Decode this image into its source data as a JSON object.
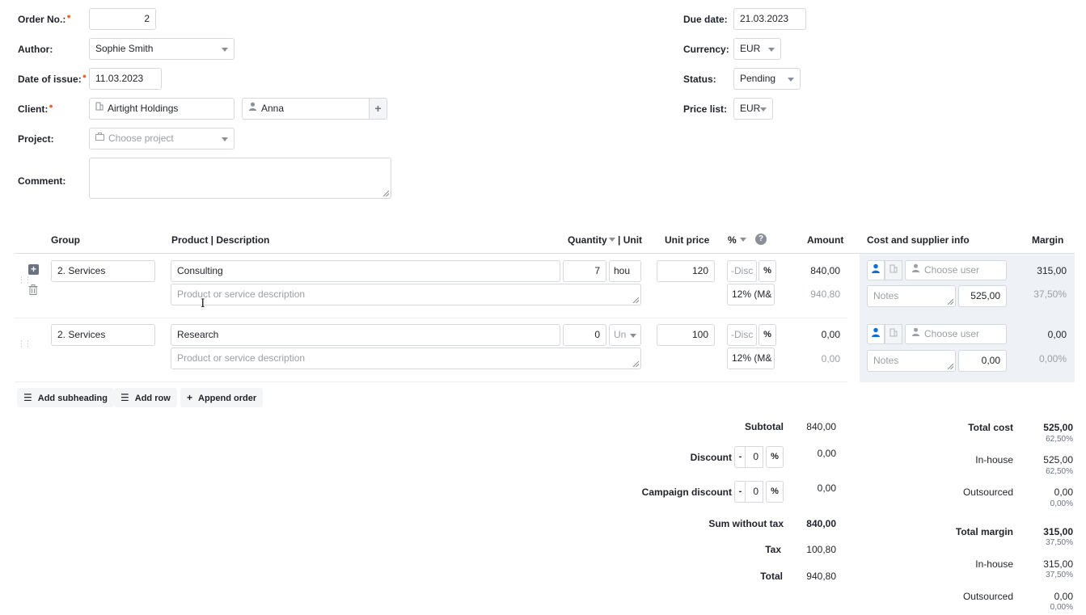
{
  "form": {
    "order_no_label": "Order No.:",
    "order_no_value": "2",
    "author_label": "Author:",
    "author_value": "Sophie Smith",
    "date_of_issue_label": "Date of issue:",
    "date_of_issue_value": "11.03.2023",
    "client_label": "Client:",
    "client_value": "Airtight Holdings",
    "contact_value": "Anna",
    "project_label": "Project:",
    "project_placeholder": "Choose project",
    "comment_label": "Comment:",
    "due_date_label": "Due date:",
    "due_date_value": "21.03.2023",
    "currency_label": "Currency:",
    "currency_value": "EUR",
    "status_label": "Status:",
    "status_value": "Pending",
    "price_list_label": "Price list:",
    "price_list_value": "EUR"
  },
  "table": {
    "headers": {
      "group": "Group",
      "product": "Product | Description",
      "quantity": "Quantity",
      "unit": "| Unit",
      "unit_price": "Unit price",
      "percent": "%",
      "amount": "Amount",
      "cost_supplier": "Cost and supplier info",
      "margin": "Margin"
    },
    "rows": [
      {
        "group": "2. Services",
        "product": "Consulting",
        "description_placeholder": "Product or service description",
        "quantity": "7",
        "unit": "hou",
        "unit_price": "120",
        "discount_placeholder": "-Disc",
        "discount_unit": "%",
        "tax": "12% (M&",
        "amount": "840,00",
        "amount_with_tax": "940,80",
        "user_placeholder": "Choose user",
        "notes_placeholder": "Notes",
        "cost": "525,00",
        "margin": "315,00",
        "margin_pct": "37,50%"
      },
      {
        "group": "2. Services",
        "product": "Research",
        "description_placeholder": "Product or service description",
        "quantity": "0",
        "unit": "Un",
        "unit_price": "100",
        "discount_placeholder": "-Disc",
        "discount_unit": "%",
        "tax": "12% (M&",
        "amount": "0,00",
        "amount_with_tax": "0,00",
        "user_placeholder": "Choose user",
        "notes_placeholder": "Notes",
        "cost": "0,00",
        "margin": "0,00",
        "margin_pct": "0,00%"
      }
    ]
  },
  "toolbar": {
    "add_subheading": "Add subheading",
    "add_row": "Add row",
    "append_order": "Append order"
  },
  "totals": {
    "subtotal_label": "Subtotal",
    "subtotal_value": "840,00",
    "discount_label": "Discount",
    "discount_sign": "-",
    "discount_input": "0",
    "discount_unit": "%",
    "discount_value": "0,00",
    "campaign_label": "Campaign discount",
    "campaign_sign": "-",
    "campaign_input": "0",
    "campaign_unit": "%",
    "campaign_value": "0,00",
    "sum_wo_tax_label": "Sum without tax",
    "sum_wo_tax_value": "840,00",
    "tax_label": "Tax",
    "tax_value": "100,80",
    "total_label": "Total",
    "total_value": "940,80"
  },
  "cost_summary": {
    "total_cost_label": "Total cost",
    "total_cost_value": "525,00",
    "total_cost_pct": "62,50%",
    "cost_inhouse_label": "In-house",
    "cost_inhouse_value": "525,00",
    "cost_inhouse_pct": "62,50%",
    "cost_outsourced_label": "Outsourced",
    "cost_outsourced_value": "0,00",
    "cost_outsourced_pct": "0,00%",
    "total_margin_label": "Total margin",
    "total_margin_value": "315,00",
    "total_margin_pct": "37,50%",
    "margin_inhouse_label": "In-house",
    "margin_inhouse_value": "315,00",
    "margin_inhouse_pct": "37,50%",
    "margin_outsourced_label": "Outsourced",
    "margin_outsourced_value": "0,00",
    "margin_outsourced_pct": "0,00%"
  },
  "colors": {
    "accent": "#0b6fd6",
    "required": "#e8692a",
    "side_panel": "#eef1f5"
  },
  "icons": [
    "building-icon",
    "user-icon",
    "plus-icon",
    "briefcase-icon",
    "help-icon",
    "drag-handle-icon",
    "trash-icon",
    "text-cursor-icon"
  ]
}
